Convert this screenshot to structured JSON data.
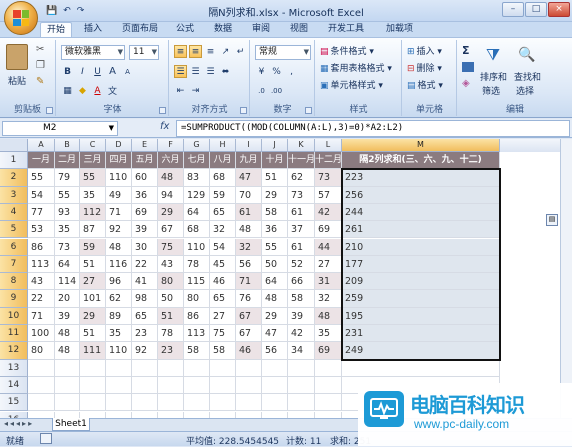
{
  "window": {
    "title": "隔N列求和.xlsx - Microsoft Excel",
    "controls": [
      "–",
      "□",
      "×"
    ]
  },
  "quick_access": {
    "save": "💾",
    "undo": "↶",
    "redo": "↷"
  },
  "tabs": [
    "开始",
    "插入",
    "页面布局",
    "公式",
    "数据",
    "审阅",
    "视图",
    "开发工具",
    "加载项"
  ],
  "active_tab": "开始",
  "ribbon": {
    "clipboard": {
      "label": "剪贴板",
      "paste": "粘贴"
    },
    "font": {
      "label": "字体",
      "name": "微软雅黑",
      "size": "11",
      "bold": "B",
      "italic": "I",
      "underline": "U",
      "grow": "A",
      "shrink": "A"
    },
    "alignment": {
      "label": "对齐方式"
    },
    "number": {
      "label": "数字",
      "format": "常规",
      "percent": "%",
      "comma": ","
    },
    "styles": {
      "label": "样式",
      "conditional": "条件格式",
      "table": "套用表格格式",
      "cell": "单元格样式"
    },
    "cells": {
      "label": "单元格",
      "insert": "插入",
      "delete": "删除",
      "format": "格式"
    },
    "editing": {
      "label": "编辑",
      "sum": "Σ",
      "sort": "排序和",
      "sort2": "筛选",
      "find": "查找和",
      "find2": "选择"
    }
  },
  "formula_bar": {
    "name_box": "M2",
    "fx": "fx",
    "formula": "=SUMPRODUCT((MOD(COLUMN(A:L),3)=0)*A2:L2)"
  },
  "columns": [
    "A",
    "B",
    "C",
    "D",
    "E",
    "F",
    "G",
    "H",
    "I",
    "J",
    "K",
    "L",
    "M"
  ],
  "rows": [
    "1",
    "2",
    "3",
    "4",
    "5",
    "6",
    "7",
    "8",
    "9",
    "10",
    "11",
    "12",
    "13",
    "14",
    "15",
    "16"
  ],
  "header_row": [
    "一月",
    "二月",
    "三月",
    "四月",
    "五月",
    "六月",
    "七月",
    "八月",
    "九月",
    "十月",
    "十一月",
    "十二月",
    "隔2列求和(三、六、九、十二)"
  ],
  "data": [
    [
      "55",
      "79",
      "55",
      "110",
      "60",
      "48",
      "83",
      "68",
      "47",
      "51",
      "62",
      "73",
      "223"
    ],
    [
      "54",
      "55",
      "35",
      "49",
      "36",
      "94",
      "129",
      "59",
      "70",
      "29",
      "73",
      "57",
      "256"
    ],
    [
      "77",
      "93",
      "112",
      "71",
      "69",
      "29",
      "64",
      "65",
      "61",
      "58",
      "61",
      "42",
      "244"
    ],
    [
      "53",
      "35",
      "87",
      "92",
      "39",
      "67",
      "68",
      "32",
      "48",
      "36",
      "37",
      "69",
      "261"
    ],
    [
      "86",
      "73",
      "59",
      "48",
      "30",
      "75",
      "110",
      "54",
      "32",
      "55",
      "61",
      "44",
      "210"
    ],
    [
      "113",
      "64",
      "51",
      "116",
      "22",
      "43",
      "78",
      "45",
      "56",
      "50",
      "52",
      "27",
      "177"
    ],
    [
      "43",
      "114",
      "27",
      "96",
      "41",
      "80",
      "115",
      "46",
      "71",
      "64",
      "66",
      "31",
      "209"
    ],
    [
      "22",
      "20",
      "101",
      "62",
      "98",
      "50",
      "80",
      "65",
      "76",
      "48",
      "58",
      "32",
      "259"
    ],
    [
      "71",
      "39",
      "29",
      "89",
      "65",
      "51",
      "86",
      "27",
      "67",
      "29",
      "39",
      "48",
      "195"
    ],
    [
      "100",
      "48",
      "51",
      "35",
      "23",
      "78",
      "113",
      "75",
      "67",
      "47",
      "42",
      "35",
      "231"
    ],
    [
      "80",
      "48",
      "111",
      "110",
      "92",
      "23",
      "58",
      "58",
      "46",
      "56",
      "34",
      "69",
      "249"
    ]
  ],
  "sheet_tab": "Sheet1",
  "status": {
    "mode": "就绪",
    "average": "平均值: 228.5454545",
    "count": "计数: 11",
    "sum": "求和: 251"
  },
  "watermark": {
    "title": "电脑百科知识",
    "url": "www.pc-daily.com"
  },
  "colors": {
    "header_fill": "#8b7b80",
    "alt_row": "#ece3e6",
    "accent": "#1d9ad6"
  }
}
